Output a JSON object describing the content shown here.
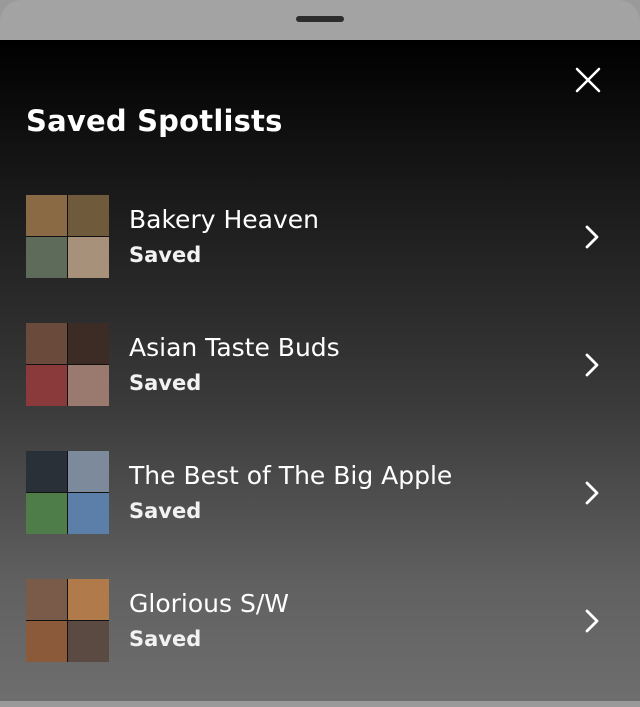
{
  "sheet": {
    "title": "Saved Spotlists",
    "close_icon": "close-icon"
  },
  "spotlists": [
    {
      "title": "Bakery Heaven",
      "status": "Saved",
      "thumb_colors": [
        "#8a6a45",
        "#6f5a3b",
        "#5e6b5a",
        "#a8917a"
      ]
    },
    {
      "title": "Asian Taste Buds",
      "status": "Saved",
      "thumb_colors": [
        "#6a4a3a",
        "#3d2c26",
        "#8a3a3a",
        "#9a7a6e"
      ]
    },
    {
      "title": "The Best of The Big Apple",
      "status": "Saved",
      "thumb_colors": [
        "#2a3038",
        "#7c8a9c",
        "#4e7d4a",
        "#5b7fa8"
      ]
    },
    {
      "title": "Glorious S/W",
      "status": "Saved",
      "thumb_colors": [
        "#7a5a48",
        "#b07a4a",
        "#8a5a3a",
        "#5a4a42"
      ]
    }
  ],
  "icons": {
    "chevron": "chevron-right-icon"
  }
}
